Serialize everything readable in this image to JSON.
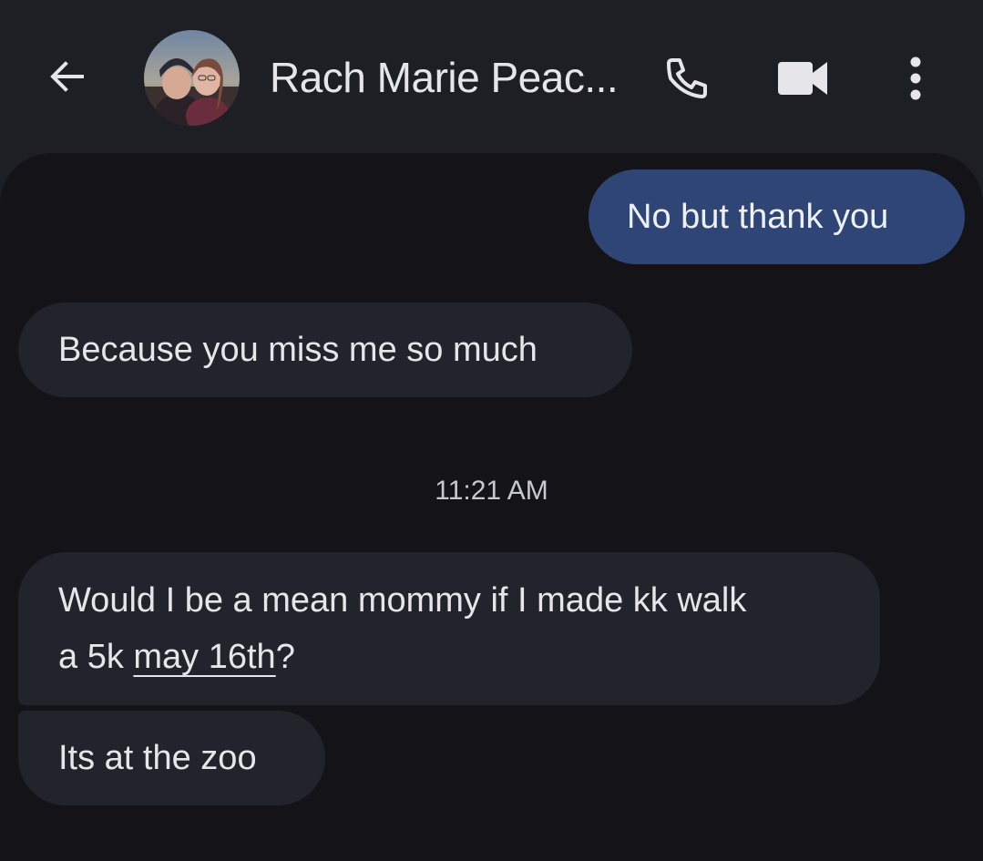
{
  "header": {
    "contact_name": "Rach Marie Peac...",
    "icons": {
      "back": "arrow-left-icon",
      "call": "phone-icon",
      "video": "video-camera-icon",
      "more": "more-vertical-icon"
    }
  },
  "messages": {
    "outgoing_1": "No but thank you",
    "incoming_1": "Because you miss me so much",
    "timestamp": "11:21 AM",
    "incoming_2_line1": "Would I be a mean mommy if I made kk walk",
    "incoming_2_line2_prefix": "a 5k ",
    "incoming_2_date": "may 16th",
    "incoming_2_line2_suffix": "?",
    "incoming_3": "Its at the zoo"
  },
  "colors": {
    "header_bg": "#1e1f25",
    "conversation_bg": "#131318",
    "outgoing_bubble": "#2f4575",
    "incoming_bubble": "#23242b",
    "text": "#e6e5ea"
  }
}
